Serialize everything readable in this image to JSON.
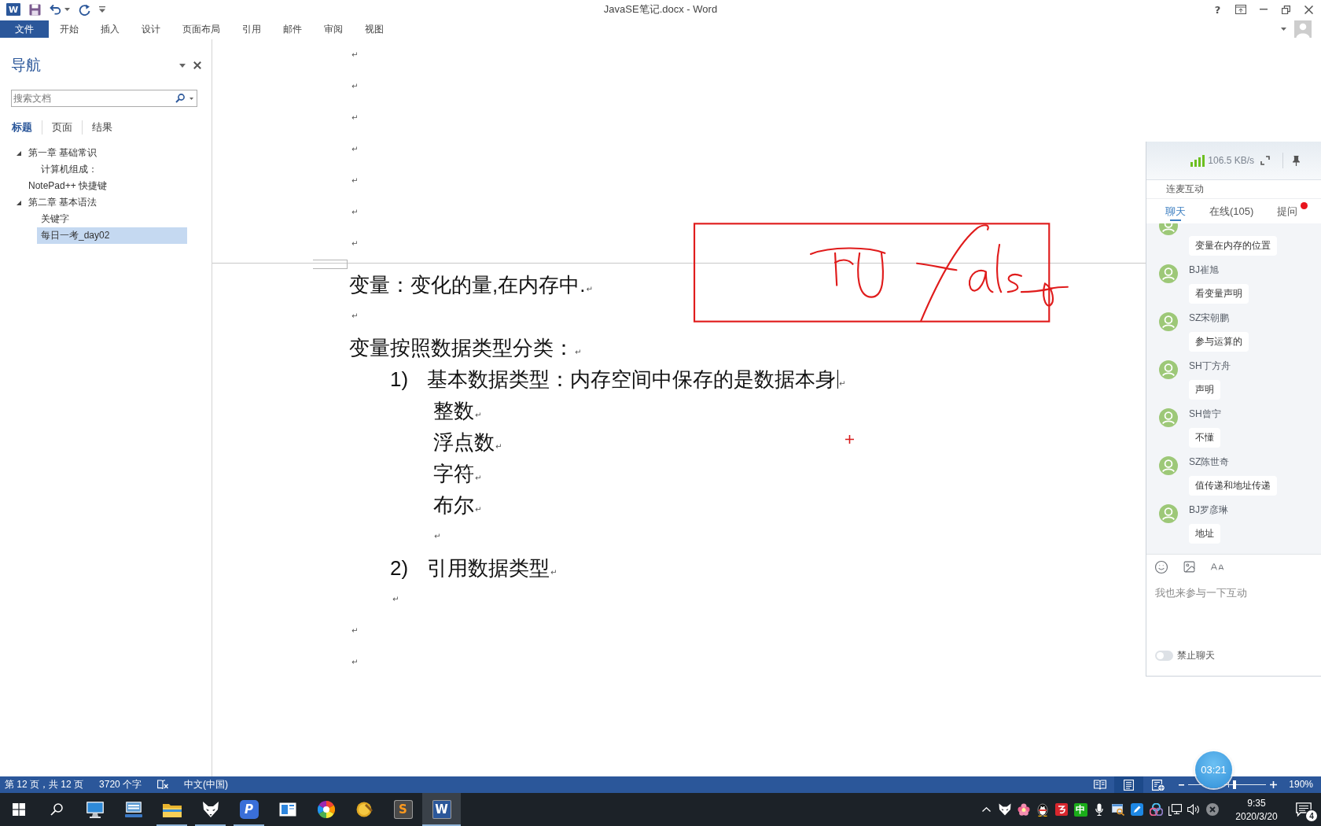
{
  "title_bar": {
    "app_glyph": "W",
    "title": "JavaSE笔记.docx - Word",
    "help": "?"
  },
  "ribbon": {
    "tabs": [
      {
        "kind": "file",
        "label": "文件",
        "selected": false
      },
      {
        "kind": "tab",
        "label": "开始",
        "selected": false
      },
      {
        "kind": "tab",
        "label": "插入",
        "selected": false
      },
      {
        "kind": "tab",
        "label": "设计",
        "selected": false
      },
      {
        "kind": "tab",
        "label": "页面布局",
        "selected": false
      },
      {
        "kind": "tab",
        "label": "引用",
        "selected": false
      },
      {
        "kind": "tab",
        "label": "邮件",
        "selected": false
      },
      {
        "kind": "tab",
        "label": "审阅",
        "selected": false
      },
      {
        "kind": "tab",
        "label": "视图",
        "selected": false
      }
    ]
  },
  "navigation": {
    "title": "导航",
    "search": {
      "placeholder": "搜索文档"
    },
    "tabs": [
      {
        "label": "标题",
        "selected": true
      },
      {
        "label": "页面",
        "selected": false
      },
      {
        "label": "结果",
        "selected": false
      }
    ],
    "headings": [
      {
        "label": "第一章 基础常识",
        "expanded": true,
        "selected": false,
        "children": [
          {
            "label": "计算机组成：",
            "selected": false
          }
        ]
      },
      {
        "label": "NotePad++ 快捷键",
        "selected": false
      },
      {
        "label": "第二章 基本语法",
        "expanded": true,
        "selected": false,
        "children": [
          {
            "label": "关键字",
            "selected": false
          },
          {
            "label": "每日一考_day02",
            "selected": true
          }
        ]
      }
    ]
  },
  "document": {
    "pages": [
      {
        "paragraphs": [
          {
            "kind": "blank",
            "mark": "↵"
          },
          {
            "kind": "blank",
            "mark": "↵"
          },
          {
            "kind": "blank",
            "mark": "↵"
          },
          {
            "kind": "blank",
            "mark": "↵"
          },
          {
            "kind": "blank",
            "mark": "↵"
          },
          {
            "kind": "blank",
            "mark": "↵"
          },
          {
            "kind": "blank",
            "mark": "↵"
          }
        ]
      },
      {
        "paragraphs": [
          {
            "kind": "text",
            "text": "变量：变化的量,在内存中.",
            "mark": "↵"
          },
          {
            "kind": "blank",
            "mark": "↵"
          },
          {
            "kind": "text",
            "text": "变量按照数据类型分类：",
            "mark": "↵"
          },
          {
            "kind": "numbered",
            "number": "1)",
            "text": "基本数据类型：内存空间中保存的是数据本身",
            "cursor": true,
            "mark": "↵"
          },
          {
            "kind": "sub",
            "text": "整数",
            "mark": "↵"
          },
          {
            "kind": "sub",
            "text": "浮点数",
            "mark": "↵"
          },
          {
            "kind": "sub",
            "text": "字符",
            "mark": "↵"
          },
          {
            "kind": "sub",
            "text": "布尔",
            "mark": "↵"
          },
          {
            "kind": "sub_blank",
            "mark": "↵"
          },
          {
            "kind": "numbered",
            "number": "2)",
            "text": "引用数据类型",
            "mark": "↵"
          },
          {
            "kind": "list_blank",
            "mark": "↵"
          },
          {
            "kind": "blank",
            "mark": "↵"
          },
          {
            "kind": "blank",
            "mark": "↵"
          }
        ]
      }
    ]
  },
  "chat": {
    "speed": "106.5 KB/s",
    "section": "连麦互动",
    "tabs": [
      {
        "label": "聊天",
        "selected": true,
        "unread": false
      },
      {
        "label": "在线(105)",
        "selected": false,
        "unread": false
      },
      {
        "label": "提问",
        "selected": false,
        "unread": true
      }
    ],
    "messages": [
      {
        "text": "变量在内存的位置"
      },
      {
        "name": "BJ崔旭",
        "text": "看变量声明"
      },
      {
        "name": "SZ宋朝鹏",
        "text": "参与运算的"
      },
      {
        "name": "SH丁方舟",
        "text": "声明"
      },
      {
        "name": "SH曾宁",
        "text": "不懂"
      },
      {
        "name": "SZ陈世奇",
        "text": "值传递和地址传递"
      },
      {
        "name": "BJ罗彦琳",
        "text": "地址"
      }
    ],
    "input": {
      "placeholder": "我也来参与一下互动"
    },
    "mute": {
      "label": "禁止聊天",
      "on": false
    }
  },
  "timer": {
    "time": "03:21"
  },
  "status_bar": {
    "page": "第 12 页，共 12 页",
    "words": "3720 个字",
    "language": "中文(中国)",
    "views": [
      {
        "kind": "read",
        "selected": false
      },
      {
        "kind": "print",
        "selected": true
      },
      {
        "kind": "web",
        "selected": false
      }
    ],
    "zoom": {
      "level": 0.59,
      "reading": "190%"
    }
  },
  "taskbar": {
    "apps": [
      {
        "kind": "monitor",
        "running": false,
        "selected": false
      },
      {
        "kind": "remote",
        "running": false,
        "selected": false
      },
      {
        "kind": "folder",
        "running": true,
        "selected": false
      },
      {
        "kind": "fox",
        "running": true,
        "selected": false
      },
      {
        "kind": "letter",
        "glyph": "P",
        "running": true,
        "selected": false
      },
      {
        "kind": "window",
        "running": false,
        "selected": false
      },
      {
        "kind": "wheel",
        "running": false,
        "selected": false
      },
      {
        "kind": "coin",
        "running": false,
        "selected": false
      },
      {
        "kind": "sublime",
        "glyph": "S",
        "running": false,
        "selected": false
      },
      {
        "kind": "word",
        "glyph": "W",
        "running": true,
        "selected": true
      }
    ],
    "ime": "中",
    "time": "9:35",
    "date": "2020/3/20",
    "notifications": "4"
  }
}
